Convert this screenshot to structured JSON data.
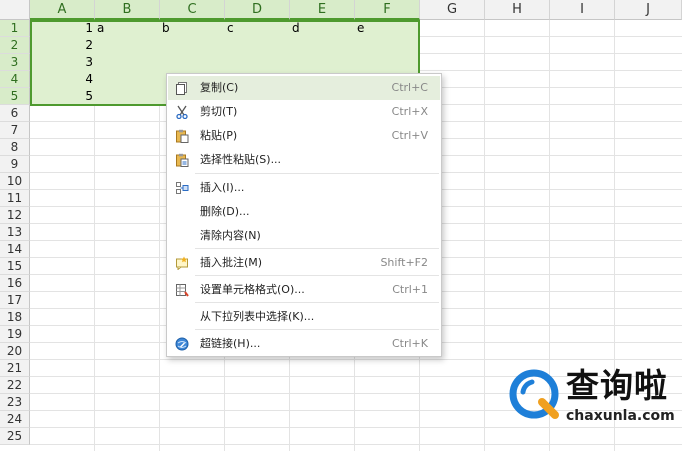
{
  "sheet": {
    "columns": [
      "A",
      "B",
      "C",
      "D",
      "E",
      "F",
      "G",
      "H",
      "I",
      "J"
    ],
    "rows": [
      "1",
      "2",
      "3",
      "4",
      "5",
      "6",
      "7",
      "8",
      "9",
      "10",
      "11",
      "12",
      "13",
      "14",
      "15",
      "16",
      "17",
      "18",
      "19",
      "20",
      "21",
      "22",
      "23",
      "24",
      "25"
    ],
    "selected_columns": [
      "A",
      "B",
      "C",
      "D",
      "E",
      "F"
    ],
    "selected_rows": [
      "1",
      "2",
      "3",
      "4",
      "5"
    ],
    "col_a_values": [
      "1",
      "2",
      "3",
      "4",
      "5"
    ],
    "row1_text": [
      "a",
      "b",
      "c",
      "d",
      "e"
    ],
    "accent_color": "#4e9a2e",
    "selection_fill": "#dff0d0"
  },
  "context_menu": {
    "items": [
      {
        "label": "复制(C)",
        "shortcut": "Ctrl+C",
        "icon": "copy-icon",
        "highlighted": true
      },
      {
        "label": "剪切(T)",
        "shortcut": "Ctrl+X",
        "icon": "scissors-icon"
      },
      {
        "label": "粘贴(P)",
        "shortcut": "Ctrl+V",
        "icon": "paste-icon"
      },
      {
        "label": "选择性粘贴(S)...",
        "shortcut": "",
        "icon": "paste-special-icon"
      },
      {
        "label": "插入(I)...",
        "shortcut": "",
        "icon": "insert-icon"
      },
      {
        "label": "删除(D)...",
        "shortcut": "",
        "icon": ""
      },
      {
        "label": "清除内容(N)",
        "shortcut": "",
        "icon": ""
      },
      {
        "label": "插入批注(M)",
        "shortcut": "Shift+F2",
        "icon": "comment-icon"
      },
      {
        "label": "设置单元格格式(O)...",
        "shortcut": "Ctrl+1",
        "icon": "format-cells-icon"
      },
      {
        "label": "从下拉列表中选择(K)...",
        "shortcut": "",
        "icon": ""
      },
      {
        "label": "超链接(H)...",
        "shortcut": "Ctrl+K",
        "icon": "hyperlink-icon"
      }
    ]
  },
  "watermark": {
    "brand_cn": "查询啦",
    "brand_en": "chaxunla.com",
    "color_blue": "#1e7fd8",
    "color_orange": "#f0a020"
  }
}
